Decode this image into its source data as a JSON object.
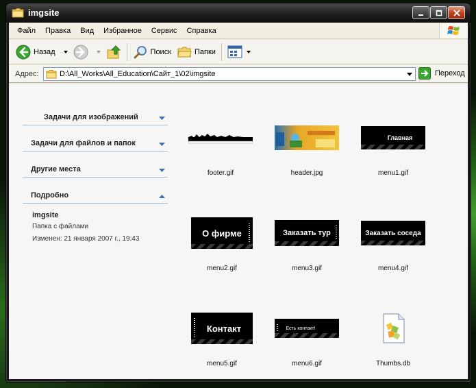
{
  "window": {
    "title": "imgsite"
  },
  "menu": [
    "Файл",
    "Правка",
    "Вид",
    "Избранное",
    "Сервис",
    "Справка"
  ],
  "toolbar": {
    "back": "Назад",
    "search": "Поиск",
    "folders": "Папки"
  },
  "address": {
    "label": "Адрес:",
    "path": "D:\\All_Works\\All_Education\\Сайт_1\\02\\imgsite",
    "go": "Переход"
  },
  "tasks": [
    {
      "label": "Задачи для изображений",
      "expanded": false
    },
    {
      "label": "Задачи для файлов и папок",
      "expanded": false
    },
    {
      "label": "Другие места",
      "expanded": false
    },
    {
      "label": "Подробно",
      "expanded": true
    }
  ],
  "details": {
    "name": "imgsite",
    "type": "Папка с файлами",
    "modified": "Изменен: 21 января 2007 г., 19:43"
  },
  "files": [
    {
      "name": "footer.gif",
      "thumb_text": ""
    },
    {
      "name": "header.jpg",
      "thumb_text": ""
    },
    {
      "name": "menu1.gif",
      "thumb_text": "Главная"
    },
    {
      "name": "menu2.gif",
      "thumb_text": "О фирме"
    },
    {
      "name": "menu3.gif",
      "thumb_text": "Заказать тур"
    },
    {
      "name": "menu4.gif",
      "thumb_text": "Заказать соседа"
    },
    {
      "name": "menu5.gif",
      "thumb_text": "Контакт"
    },
    {
      "name": "menu6.gif",
      "thumb_text": "Есть контакт!"
    },
    {
      "name": "Thumbs.db",
      "thumb_text": ""
    }
  ],
  "colors": {
    "titlebar": "#1e1e1e",
    "close_button": "#c4411e",
    "task_header_line": "#a9bcd7"
  }
}
